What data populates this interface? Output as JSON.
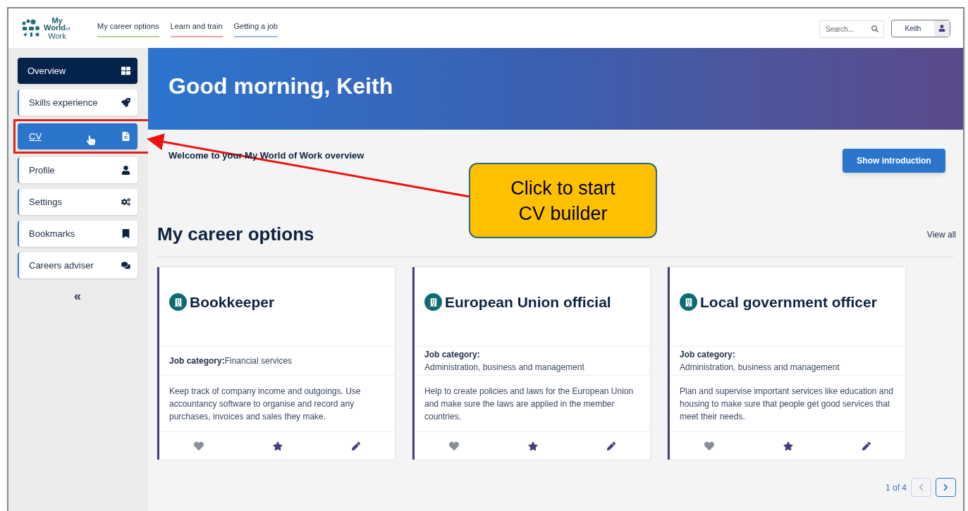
{
  "header": {
    "logo": {
      "line1": "My",
      "line2": "World",
      "line2_small": "or",
      "line3": "Work"
    },
    "nav": [
      {
        "label": "My career options",
        "color": "#b5cf8a"
      },
      {
        "label": "Learn and train",
        "color": "#f0a0a8"
      },
      {
        "label": "Getting a job",
        "color": "#9ab8e0"
      }
    ],
    "search": {
      "placeholder": "Search..."
    },
    "user": {
      "name": "Keith"
    }
  },
  "sidebar": {
    "items": [
      {
        "label": "Overview",
        "selected": true,
        "highlighted": false
      },
      {
        "label": "Skills experience",
        "selected": false,
        "highlighted": false
      },
      {
        "label": "CV",
        "selected": false,
        "highlighted": true
      },
      {
        "label": "Profile",
        "selected": false,
        "highlighted": false
      },
      {
        "label": "Settings",
        "selected": false,
        "highlighted": false
      },
      {
        "label": "Bookmarks",
        "selected": false,
        "highlighted": false
      },
      {
        "label": "Careers adviser",
        "selected": false,
        "highlighted": false
      }
    ],
    "collapse": "«"
  },
  "banner": {
    "greeting": "Good morning, Keith"
  },
  "welcome": "Welcome to your My World of Work overview",
  "intro_button": "Show introduction",
  "careers": {
    "heading": "My career options",
    "view_all": "View all",
    "cards": [
      {
        "title": "Bookkeeper",
        "category_label": "Job category:",
        "category": "Financial services",
        "kind": "inline",
        "description": "Keep track of company income and outgoings. Use accountancy software to organise and record any purchases, invoices and sales they make."
      },
      {
        "title": "European Union official",
        "category_label": "Job category:",
        "category": "Administration, business and management",
        "kind": "stacked",
        "description": "Help to create policies and laws for the European Union and make sure the laws are applied in the member countries."
      },
      {
        "title": "Local government officer",
        "category_label": "Job category:",
        "category": "Administration, business and management",
        "kind": "stacked",
        "description": "Plan and supervise important services like education and housing to make sure that people get good services that meet their needs."
      }
    ],
    "pager": "1 of 4"
  },
  "annotation": {
    "text": "Click to start CV builder"
  }
}
